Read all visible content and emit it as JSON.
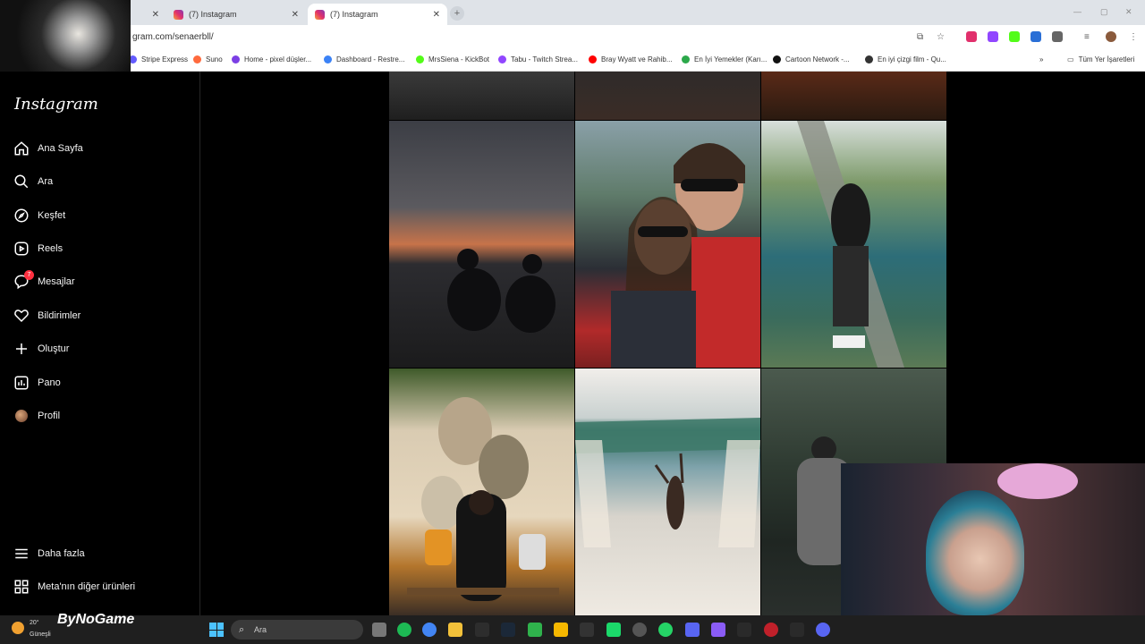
{
  "browser": {
    "tabs": [
      {
        "title": "(7) Instagram",
        "active": false
      },
      {
        "title": "(7) Instagram",
        "active": true
      }
    ],
    "url": "gram.com/senaerbll/",
    "bookmarks": [
      {
        "label": "Stripe Express",
        "color": "#635bff"
      },
      {
        "label": "Suno",
        "color": "#ff6a3d"
      },
      {
        "label": "Home - pixel düşler...",
        "color": "#7b3fe4"
      },
      {
        "label": "Dashboard - Restre...",
        "color": "#3b82f6"
      },
      {
        "label": "MrsSiena - KickBot",
        "color": "#53fc18"
      },
      {
        "label": "Tabu - Twitch Strea...",
        "color": "#9146ff"
      },
      {
        "label": "Bray Wyatt ve Rahib...",
        "color": "#ff0000"
      },
      {
        "label": "En İyi Yemekler (Karı...",
        "color": "#2ba84a"
      },
      {
        "label": "Cartoon Network -...",
        "color": "#111111"
      },
      {
        "label": "En iyi çizgi film - Qu...",
        "color": "#333333"
      }
    ],
    "bookmarks_folder": "Tüm Yer İşaretleri"
  },
  "sidebar": {
    "logo": "Instagram",
    "items": [
      {
        "label": "Ana Sayfa",
        "icon": "home-icon"
      },
      {
        "label": "Ara",
        "icon": "search-icon"
      },
      {
        "label": "Keşfet",
        "icon": "compass-icon"
      },
      {
        "label": "Reels",
        "icon": "reels-icon"
      },
      {
        "label": "Mesajlar",
        "icon": "messenger-icon",
        "badge": "7"
      },
      {
        "label": "Bildirimler",
        "icon": "heart-icon"
      },
      {
        "label": "Oluştur",
        "icon": "plus-icon"
      },
      {
        "label": "Pano",
        "icon": "dashboard-icon"
      },
      {
        "label": "Profil",
        "icon": "avatar"
      }
    ],
    "more": "Daha fazla",
    "meta": "Meta'nın diğer ürünleri"
  },
  "taskbar": {
    "weather_temp": "20°",
    "weather_desc": "Güneşli",
    "search_placeholder": "Ara",
    "brand": "ByNoGame"
  }
}
